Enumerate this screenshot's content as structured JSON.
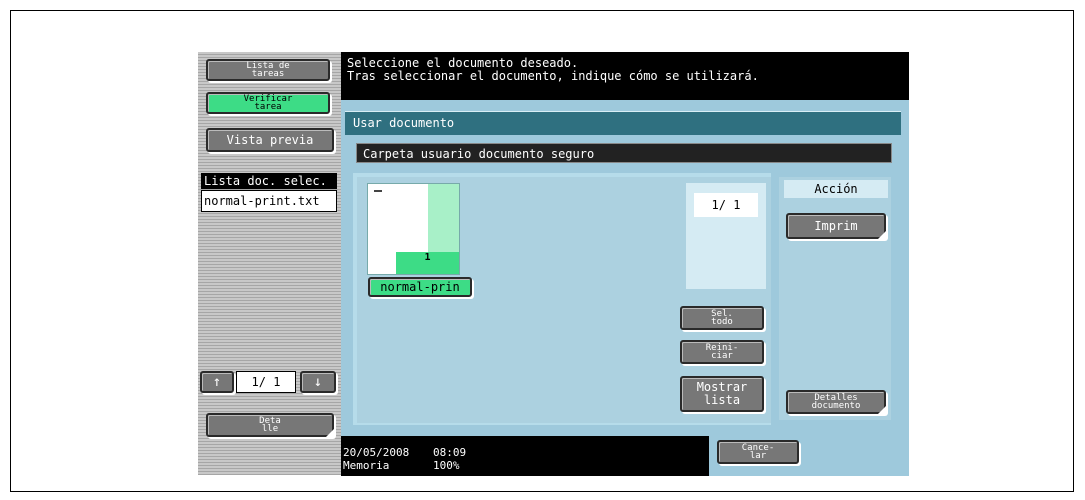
{
  "sidebar": {
    "job_list_label": "Lista de\ntareas",
    "check_job_label": "Verificar\ntarea",
    "preview_label": "Vista previa",
    "selected_list_header": "Lista doc. selec.",
    "selected_items": [
      "normal-print.txt"
    ],
    "page_indicator": "1/  1",
    "detail_label": "Deta\nlle"
  },
  "header": {
    "line1": "Seleccione el documento deseado.",
    "line2": "Tras seleccionar el documento, indique cómo se utilizará."
  },
  "panel": {
    "title": "Usar documento",
    "folder": "Carpeta usuario documento seguro",
    "document": {
      "badge": "1",
      "name": "normal-prin"
    },
    "page_counter": "1/  1",
    "select_all_label": "Sel.\ntodo",
    "reset_label": "Reini-\nciar",
    "show_list_label": "Mostrar\nlista"
  },
  "action": {
    "header": "Acción",
    "print_label": "Imprim",
    "details_label": "Detalles\ndocumento"
  },
  "status": {
    "date": "20/05/2008",
    "time": "08:09",
    "memory_label": "Memoria",
    "memory_value": "100%"
  },
  "footer": {
    "cancel_label": "Cance-\nlar"
  },
  "colors": {
    "green": "#3ddc86",
    "teal": "#2f7080",
    "panel": "#9ec9dc"
  }
}
